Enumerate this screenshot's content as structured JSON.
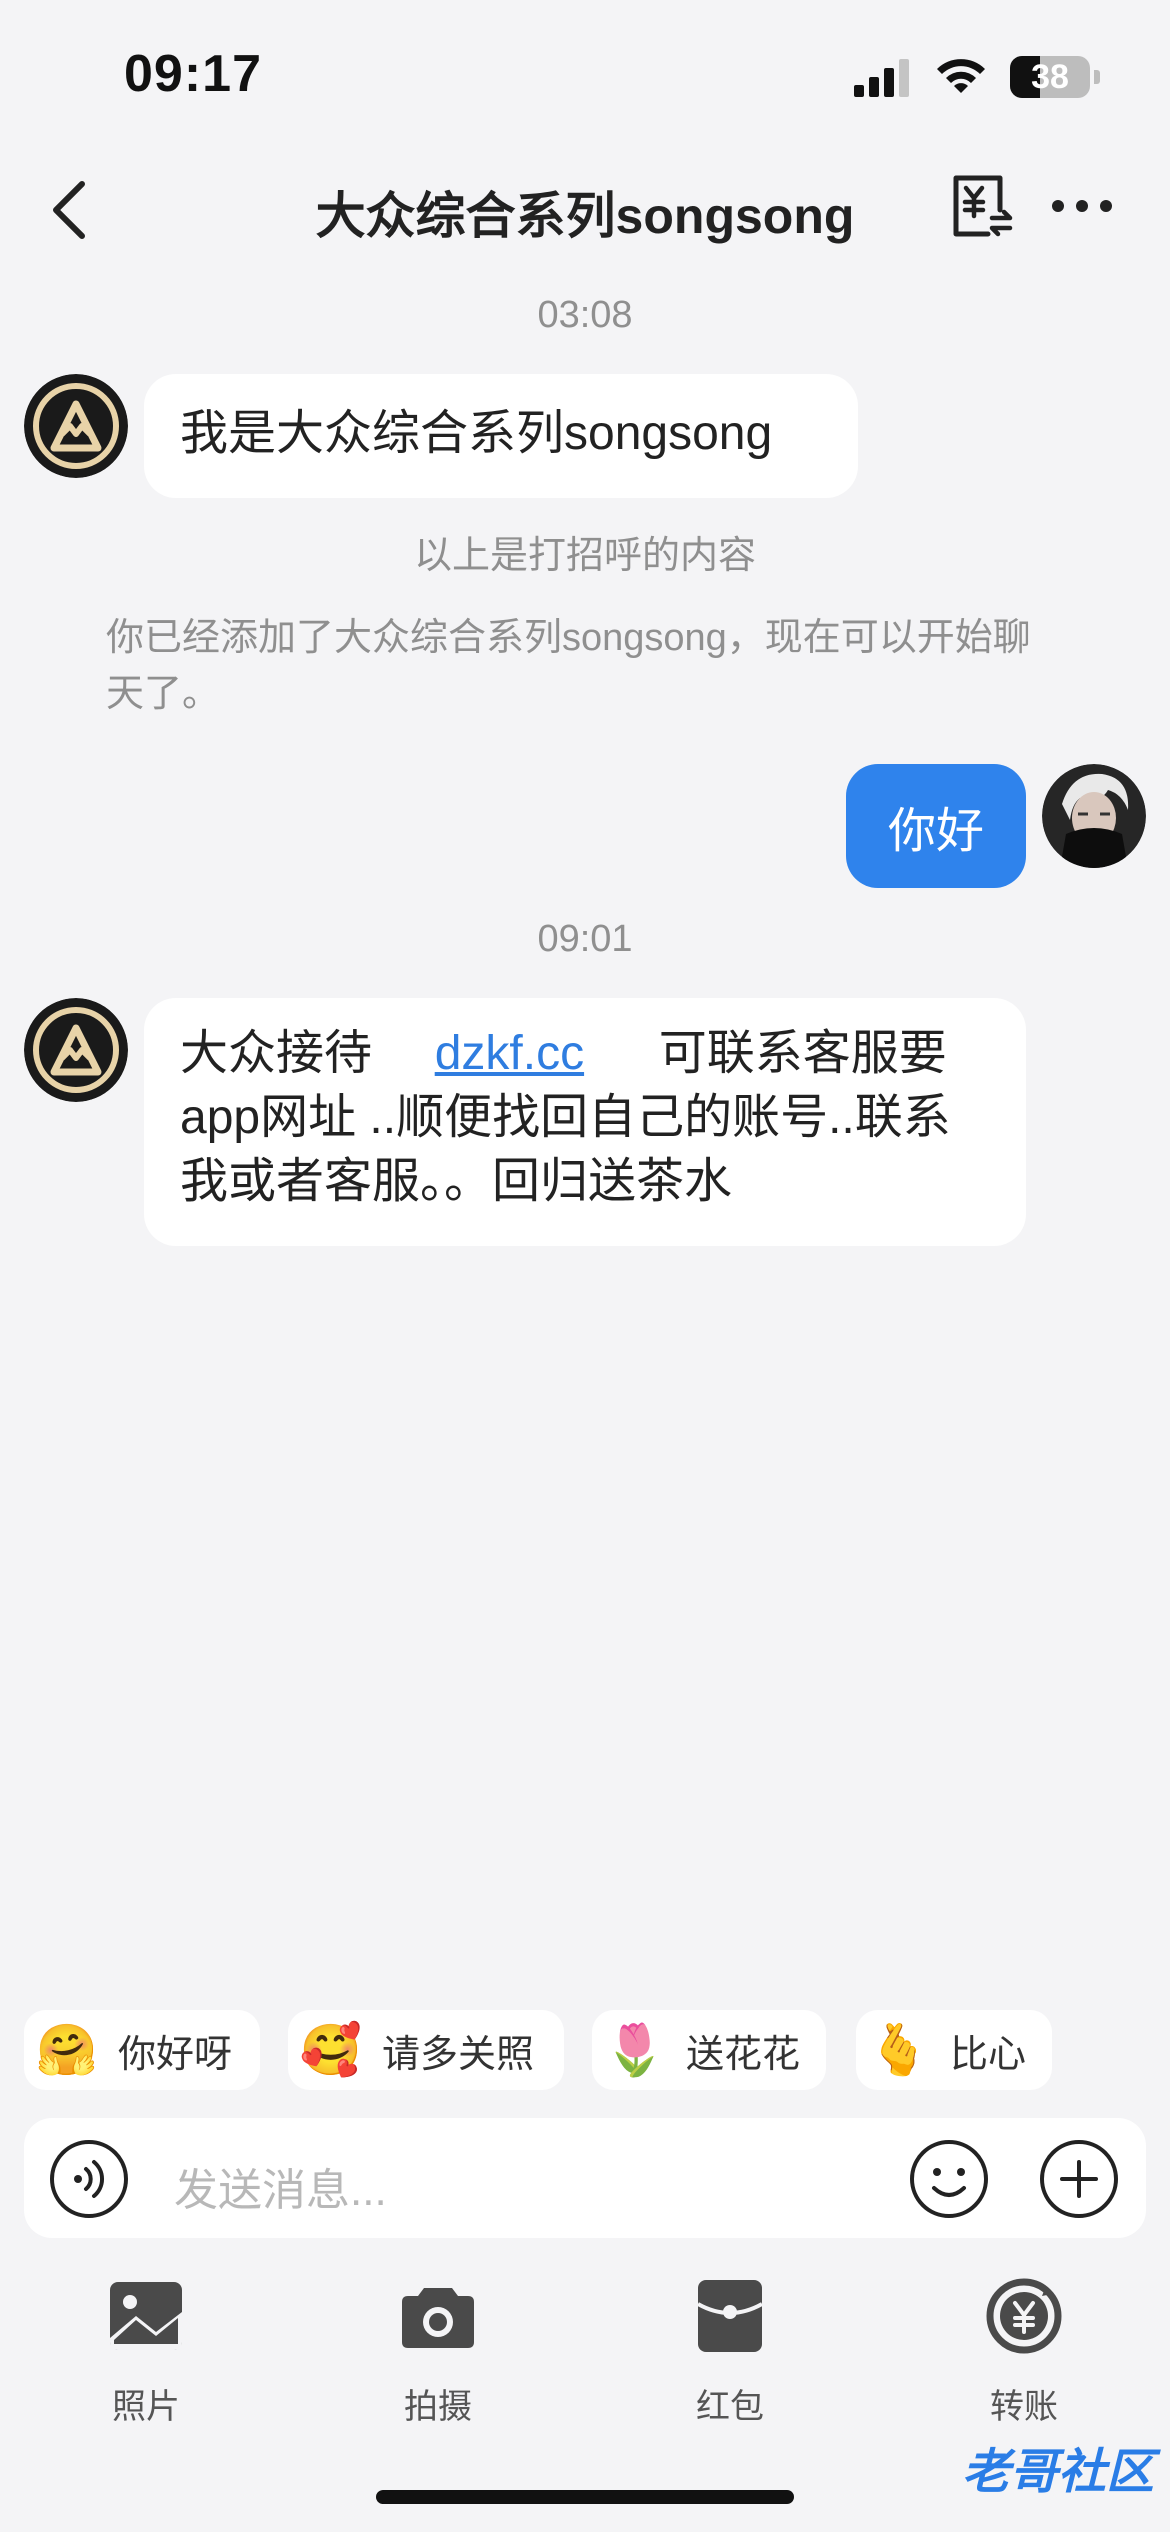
{
  "status_bar": {
    "time": "09:17",
    "battery": "38"
  },
  "nav": {
    "title": "大众综合系列songsong"
  },
  "chat": {
    "time_1": "03:08",
    "greeting_message": "我是大众综合系列songsong",
    "greeting_note": "以上是打招呼的内容",
    "added_notice": "你已经添加了大众综合系列songsong，现在可以开始聊天了。",
    "my_message": "你好",
    "time_2": "09:01",
    "msg2_part1": "大众接待",
    "msg2_link": "dzkf.cc",
    "msg2_part2": "可联系客服要app网址 ..顺便找回自己的账号..联系我或者客服。。回归送茶水"
  },
  "quick_replies": [
    {
      "label": "你好呀",
      "icon": "smiling-face-icon"
    },
    {
      "label": "请多关照",
      "icon": "hugging-face-hearts-icon"
    },
    {
      "label": "送花花",
      "icon": "flower-hand-icon"
    },
    {
      "label": "比心",
      "icon": "finger-heart-icon"
    }
  ],
  "input": {
    "placeholder": "发送消息..."
  },
  "actions": [
    {
      "label": "照片",
      "icon": "photo-icon"
    },
    {
      "label": "拍摄",
      "icon": "camera-icon"
    },
    {
      "label": "红包",
      "icon": "red-packet-icon"
    },
    {
      "label": "转账",
      "icon": "transfer-yuan-icon"
    }
  ],
  "watermark": "老哥社区",
  "colors": {
    "accent": "#2f83ec",
    "background": "#f4f4f6",
    "link": "#2f7de0"
  }
}
